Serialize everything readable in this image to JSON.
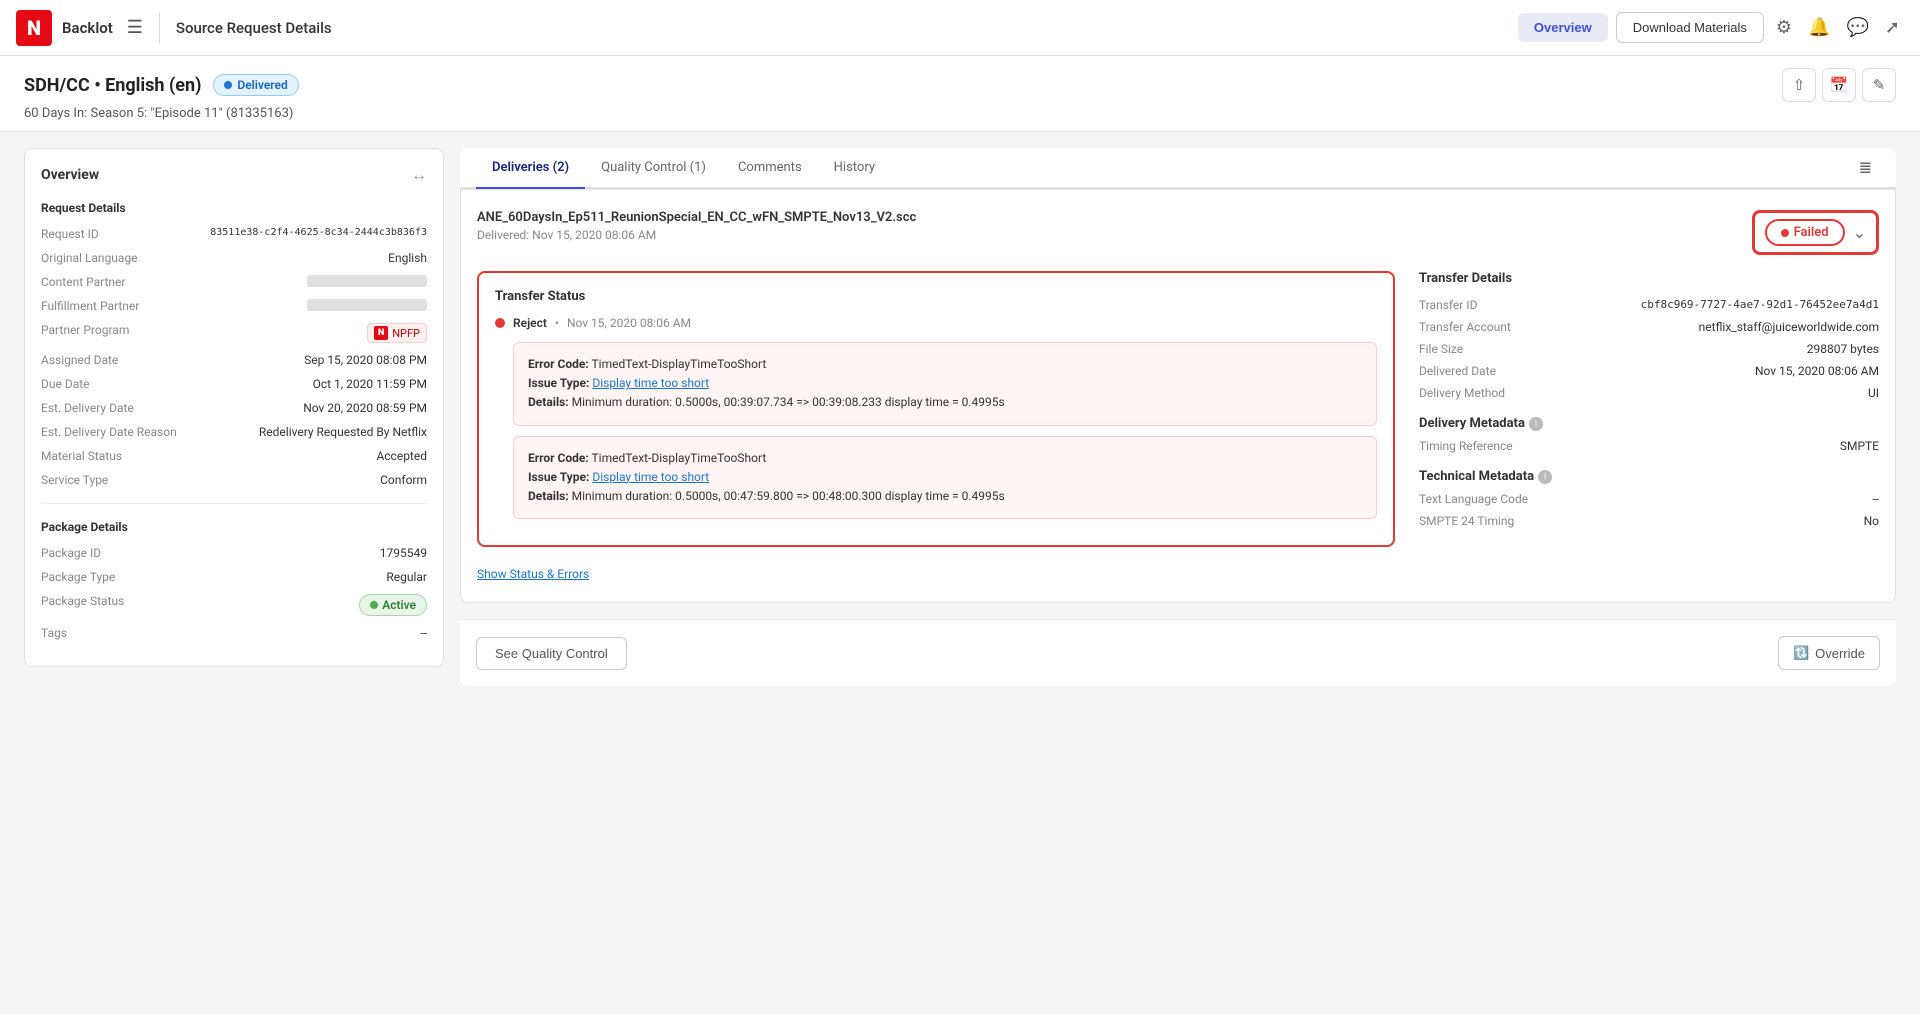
{
  "header": {
    "logo": "N",
    "app_name": "Backlot",
    "page_title": "Source Request Details",
    "btn_overview": "Overview",
    "btn_download": "Download Materials"
  },
  "sub_header": {
    "title": "SDH/CC • English (en)",
    "badge": "Delivered",
    "subtitle": "60 Days In: Season 5: \"Episode 11\"  (81335163)"
  },
  "sidebar": {
    "title": "Overview",
    "request_details_title": "Request Details",
    "fields": [
      {
        "label": "Request ID",
        "value": "83511e38-c2f4-4625-8c34-2444c3b836f3",
        "type": "mono"
      },
      {
        "label": "Original Language",
        "value": "English"
      },
      {
        "label": "Content Partner",
        "value": "BLURRED"
      },
      {
        "label": "Fulfillment Partner",
        "value": "BLURRED"
      },
      {
        "label": "Partner Program",
        "value": "NPFP",
        "type": "badge"
      },
      {
        "label": "Assigned Date",
        "value": "Sep 15, 2020 08:08 PM"
      },
      {
        "label": "Due Date",
        "value": "Oct 1, 2020 11:59 PM"
      },
      {
        "label": "Est. Delivery Date",
        "value": "Nov 20, 2020 08:59 PM"
      },
      {
        "label": "Est. Delivery Date Reason",
        "value": "Redelivery Requested By Netflix"
      },
      {
        "label": "Material Status",
        "value": "Accepted"
      },
      {
        "label": "Service Type",
        "value": "Conform"
      }
    ],
    "package_details_title": "Package Details",
    "package_fields": [
      {
        "label": "Package ID",
        "value": "1795549"
      },
      {
        "label": "Package Type",
        "value": "Regular"
      },
      {
        "label": "Package Status",
        "value": "Active",
        "type": "badge-active"
      },
      {
        "label": "Tags",
        "value": "--"
      }
    ]
  },
  "tabs": [
    {
      "label": "Deliveries (2)",
      "active": true
    },
    {
      "label": "Quality Control (1)",
      "active": false
    },
    {
      "label": "Comments",
      "active": false
    },
    {
      "label": "History",
      "active": false
    }
  ],
  "delivery": {
    "filename": "ANE_60DaysIn_Ep511_ReunionSpecial_EN_CC_wFN_SMPTE_Nov13_V2.scc",
    "delivered_label": "Delivered:",
    "delivered_date": "Nov 15, 2020 08:06 AM",
    "status": "Failed",
    "transfer_status_title": "Transfer Status",
    "reject_label": "Reject",
    "reject_time": "Nov 15, 2020 08:06 AM",
    "errors": [
      {
        "error_code_label": "Error Code:",
        "error_code": "TimedText-DisplayTimeTooShort",
        "issue_type_label": "Issue Type:",
        "issue_type": "Display time too short",
        "details_label": "Details:",
        "details": "Minimum duration: 0.5000s, 00:39:07.734 => 00:39:08.233 display time = 0.4995s"
      },
      {
        "error_code_label": "Error Code:",
        "error_code": "TimedText-DisplayTimeTooShort",
        "issue_type_label": "Issue Type:",
        "issue_type": "Display time too short",
        "details_label": "Details:",
        "details": "Minimum duration: 0.5000s, 00:47:59.800 => 00:48:00.300 display time = 0.4995s"
      }
    ],
    "show_errors_link": "Show Status & Errors",
    "transfer_details_title": "Transfer Details",
    "transfer_id_label": "Transfer ID",
    "transfer_id": "cbf8c969-7727-4ae7-92d1-76452ee7a4d1",
    "transfer_account_label": "Transfer Account",
    "transfer_account": "netflix_staff@juiceworldwide.com",
    "file_size_label": "File Size",
    "file_size": "298807 bytes",
    "delivered_date_label": "Delivered Date",
    "delivered_date_val": "Nov 15, 2020 08:06 AM",
    "delivery_method_label": "Delivery Method",
    "delivery_method": "UI",
    "delivery_metadata_label": "Delivery Metadata",
    "timing_reference_label": "Timing Reference",
    "timing_reference": "SMPTE",
    "technical_metadata_label": "Technical Metadata",
    "text_lang_code_label": "Text Language Code",
    "text_lang_code": "--",
    "smpte_24_label": "SMPTE 24 Timing",
    "smpte_24": "No",
    "btn_qc": "See Quality Control",
    "btn_override": "Override"
  }
}
